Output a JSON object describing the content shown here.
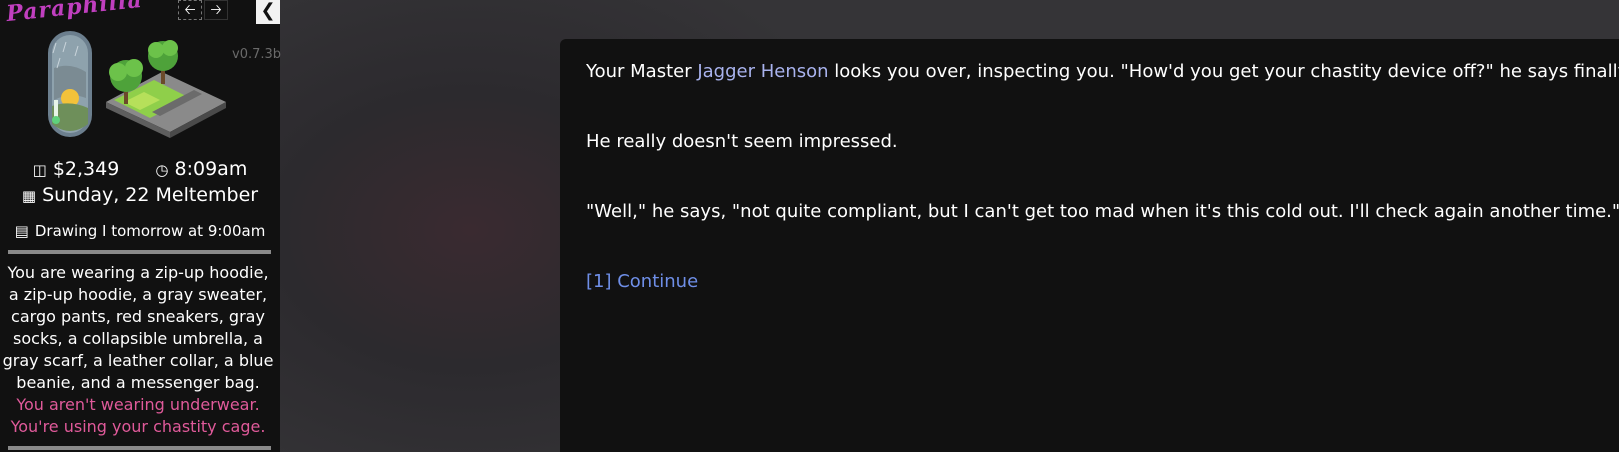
{
  "sidebar": {
    "logo_text": "Paraphilia",
    "back_icon": "arrow-left-icon",
    "forward_icon": "arrow-right-icon",
    "collapse_icon": "chevron-left-icon",
    "version": "v0.7.3b",
    "money": "$2,349",
    "time": "8:09am",
    "date": "Sunday, 22 Meltember",
    "schedule": "Drawing I tomorrow at 9:00am",
    "clothing_text": "You are wearing a zip-up hoodie, a zip-up hoodie, a gray sweater, cargo pants, red sneakers, gray socks, a collapsible umbrella, a gray scarf, a leather collar, a blue beanie, and a messenger bag.",
    "clothing_warning": "You aren't wearing underwear. You're using your chastity cage."
  },
  "main": {
    "p1_before": "Your Master ",
    "p1_name": "Jagger Henson",
    "p1_after": " looks you over, inspecting you. \"How'd you get your chastity device off?\" he says finally.",
    "p2": "He really doesn't seem impressed.",
    "p3": "\"Well,\" he says, \"not quite compliant, but I can't get too mad when it's this cold out. I'll check again another time.\"",
    "continue_link": "[1] Continue"
  },
  "colors": {
    "panel_bg": "#111111",
    "link_blue": "#6f8fe8",
    "name_link": "#a9b3ee",
    "warning_pink": "#e05a9a",
    "logo_magenta": "#c03fbf"
  }
}
